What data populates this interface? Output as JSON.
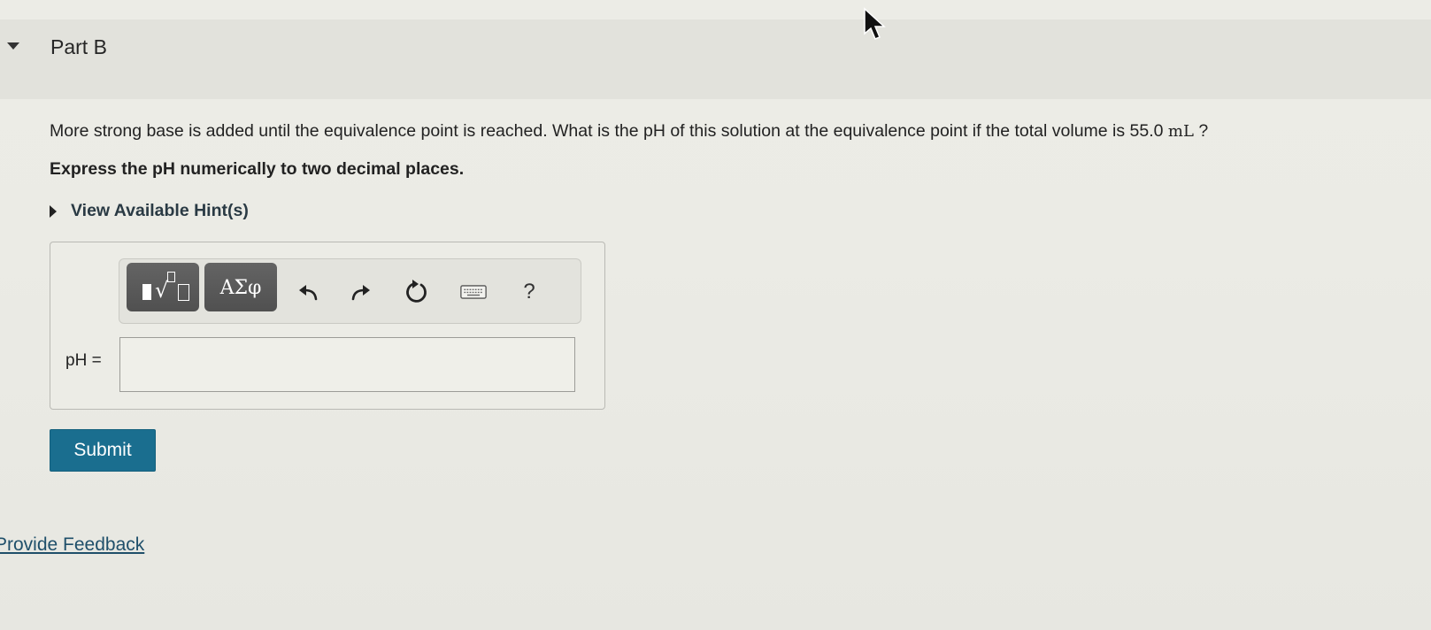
{
  "part": {
    "title": "Part B"
  },
  "question": {
    "text": "More strong base is added until the equivalence point is reached. What is the pH of this solution at the equivalence point if the total volume is 55.0 ",
    "unit": "mL",
    "suffix": " ?",
    "instruction": "Express the pH numerically to two decimal places."
  },
  "hints": {
    "label": "View Available Hint(s)"
  },
  "toolbar": {
    "greek_label": "ΑΣφ",
    "help_label": "?",
    "icons": [
      "templates-icon",
      "greek-symbols-icon",
      "undo-icon",
      "redo-icon",
      "reset-icon",
      "keyboard-icon",
      "help-icon"
    ]
  },
  "answer": {
    "label": "pH =",
    "value": ""
  },
  "submit": {
    "label": "Submit",
    "color": "#1a6e8f"
  },
  "feedback": {
    "label": "Provide Feedback"
  }
}
